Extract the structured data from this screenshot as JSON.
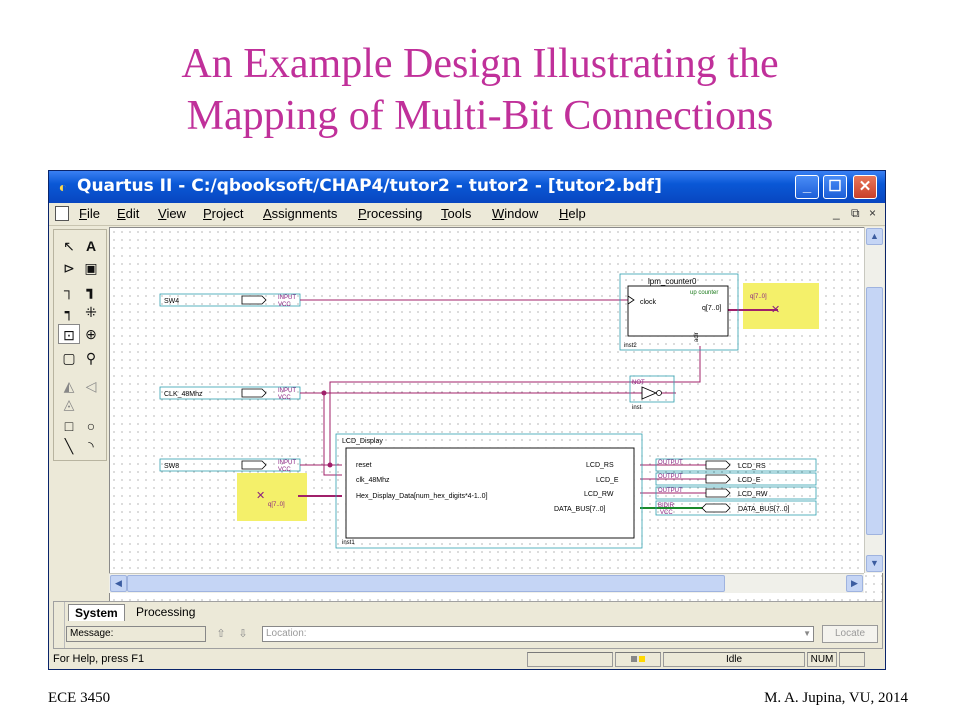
{
  "slide": {
    "title_line1": "An Example Design Illustrating the",
    "title_line2": "Mapping of Multi-Bit Connections",
    "footer_left": "ECE 3450",
    "footer_right": "M. A. Jupina, VU, 2014",
    "title_color": "#c0309a"
  },
  "window": {
    "title": "Quartus II - C:/qbooksoft/CHAP4/tutor2 - tutor2 - [tutor2.bdf]",
    "controls": [
      "minimize-icon",
      "maximize-icon",
      "close-icon"
    ]
  },
  "menu": {
    "items": [
      "File",
      "Edit",
      "View",
      "Project",
      "Assignments",
      "Processing",
      "Tools",
      "Window",
      "Help"
    ],
    "mdi_minimize": "_",
    "mdi_restore": "⧉",
    "mdi_close": "×"
  },
  "toolbar": {
    "tools": [
      "selection-icon",
      "text-icon",
      "symbol-icon",
      "block-icon",
      "orthogonal-node-icon",
      "orthogonal-bus-icon",
      "conduit-icon",
      "rubberband-icon",
      "partial-select-icon",
      "zoom-icon",
      "fullscreen-icon",
      "find-icon",
      "flip-horizontal-icon",
      "flip-vertical-icon",
      "rotate-icon",
      "rectangle-icon",
      "oval-icon",
      "line-icon",
      "arc-icon"
    ]
  },
  "schematic": {
    "inputs": [
      {
        "name": "SW4",
        "type": "INPUT",
        "vcc": "VCC"
      },
      {
        "name": "CLK_48Mhz",
        "type": "INPUT",
        "vcc": "VCC"
      },
      {
        "name": "SW8",
        "type": "INPUT",
        "vcc": "VCC"
      }
    ],
    "counter": {
      "name": "lpm_counter0",
      "ports": [
        "clock",
        "up counter",
        "q[7..0]",
        "aclr"
      ],
      "inst": "inst2",
      "out_label": "q[7..0]"
    },
    "not_gate": {
      "label": "NOT",
      "inst": "inst"
    },
    "lcd": {
      "name": "LCD_Display",
      "inputs": [
        "reset",
        "clk_48Mhz",
        "Hex_Display_Data[num_hex_digits*4-1..0]"
      ],
      "outputs": [
        "LCD_RS",
        "LCD_E",
        "LCD_RW",
        "DATA_BUS[7..0]"
      ],
      "inst": "inst1",
      "in_label": "q[7..0]"
    },
    "outputs": [
      {
        "name": "LCD_RS",
        "type": "OUTPUT"
      },
      {
        "name": "LCD_E",
        "type": "OUTPUT"
      },
      {
        "name": "LCD_RW",
        "type": "OUTPUT"
      },
      {
        "name": "DATA_BUS[7..0]",
        "type": "BIDIR",
        "vcc": "VCC"
      }
    ],
    "wire_color": "#a0206a",
    "highlight_color": "#f4f06a"
  },
  "messages": {
    "tabs": [
      "System",
      "Processing"
    ],
    "message_label": "Message:",
    "location_placeholder": "Location:",
    "locate_button": "Locate"
  },
  "status": {
    "help_text": "For Help, press F1",
    "state": "Idle",
    "num": "NUM"
  }
}
